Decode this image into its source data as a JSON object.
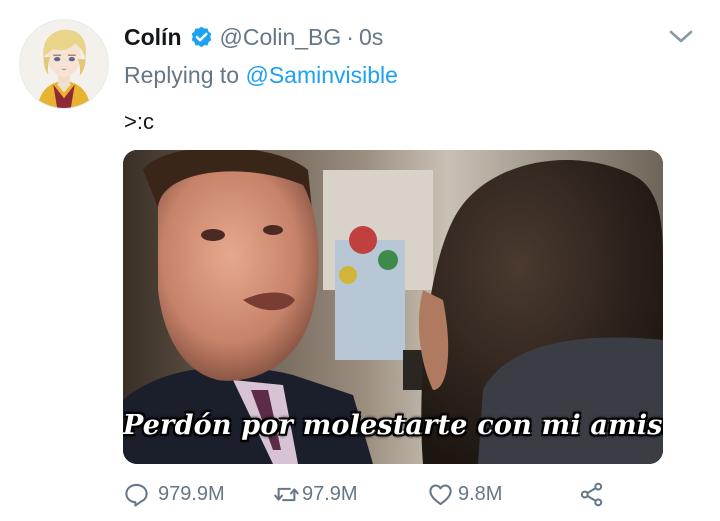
{
  "tweet": {
    "author_name": "Colín",
    "author_handle": "@Colin_BG",
    "separator": "·",
    "timestamp": "0s",
    "replying_prefix": "Replying to",
    "replying_to": "@Saminvisible",
    "text": ">:c",
    "media_caption": "Perdón por molestarte con mi amistad",
    "reply_count": "979.9M",
    "retweet_count": "97.9M",
    "like_count": "9.8M"
  },
  "icons": {
    "verified": "verified-badge-icon",
    "more": "chevron-down-icon",
    "reply": "comment-bubble-icon",
    "retweet": "retweet-arrows-icon",
    "like": "heart-icon",
    "share": "share-nodes-icon"
  },
  "colors": {
    "link": "#1da1f2",
    "muted": "#657786",
    "text": "#14171a"
  }
}
